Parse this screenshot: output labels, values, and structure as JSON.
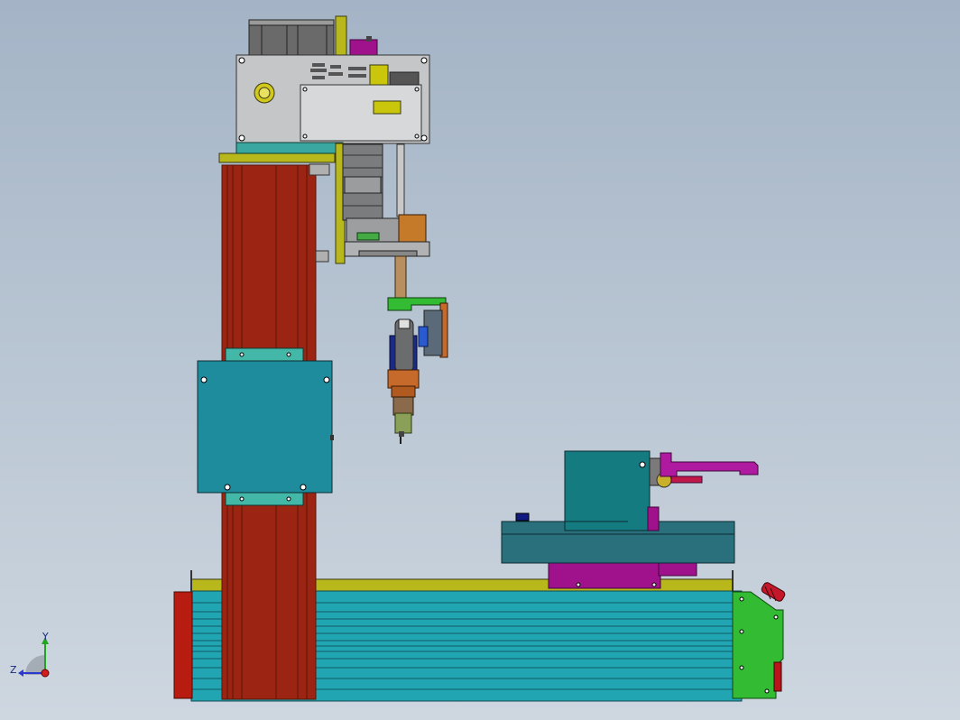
{
  "viewport": {
    "background_top": "#a4b4c6",
    "background_bottom": "#ced7e0"
  },
  "triad": {
    "y_label": "Y",
    "z_label": "Z",
    "y_axis_color": "#1fa51f",
    "z_axis_color": "#2a3ad0",
    "x_axis_color": "#d21e1e"
  },
  "colors": {
    "column": "#9c2412",
    "column_edge": "#5a1508",
    "carriage_plate": "#1e8c9c",
    "base_rail": "#21a5b2",
    "base_top": "#b8b81c",
    "gearbox": "#c4c6c8",
    "yellow_part": "#c9c60c",
    "green_part": "#44bb44",
    "orange_part": "#c56a2a",
    "magenta_part": "#a0128c",
    "table_block": "#2a6f7c",
    "table_box": "#147b80"
  }
}
